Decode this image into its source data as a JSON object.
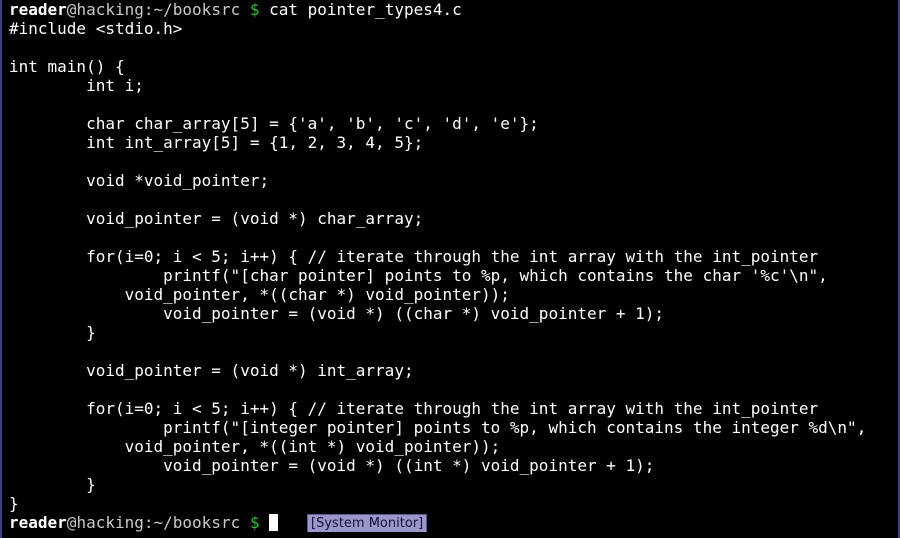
{
  "prompt_top": {
    "user": "reader",
    "at": "@",
    "host": "hacking",
    "colon": ":",
    "path": "~/booksrc",
    "dollar": " $ ",
    "command": "cat pointer_types4.c"
  },
  "code_lines": [
    "#include <stdio.h>",
    "",
    "int main() {",
    "        int i;",
    "",
    "        char char_array[5] = {'a', 'b', 'c', 'd', 'e'};",
    "        int int_array[5] = {1, 2, 3, 4, 5};",
    "",
    "        void *void_pointer;",
    "",
    "        void_pointer = (void *) char_array;",
    "",
    "        for(i=0; i < 5; i++) { // iterate through the int array with the int_pointer",
    "                printf(\"[char pointer] points to %p, which contains the char '%c'\\n\",",
    "            void_pointer, *((char *) void_pointer));",
    "                void_pointer = (void *) ((char *) void_pointer + 1);",
    "        }",
    "",
    "        void_pointer = (void *) int_array;",
    "",
    "        for(i=0; i < 5; i++) { // iterate through the int array with the int_pointer",
    "                printf(\"[integer pointer] points to %p, which contains the integer %d\\n\",",
    "            void_pointer, *((int *) void_pointer));",
    "                void_pointer = (void *) ((int *) void_pointer + 1);",
    "        }",
    "}"
  ],
  "prompt_bottom": {
    "user": "reader",
    "at": "@",
    "host": "hacking",
    "colon": ":",
    "path": "~/booksrc",
    "dollar": " $ "
  },
  "tooltip": {
    "label": "[System Monitor]"
  },
  "colors": {
    "background": "#000000",
    "text": "#ffffff",
    "prompt_dollar": "#2fbf2f",
    "tooltip_bg": "#9a98c8"
  }
}
